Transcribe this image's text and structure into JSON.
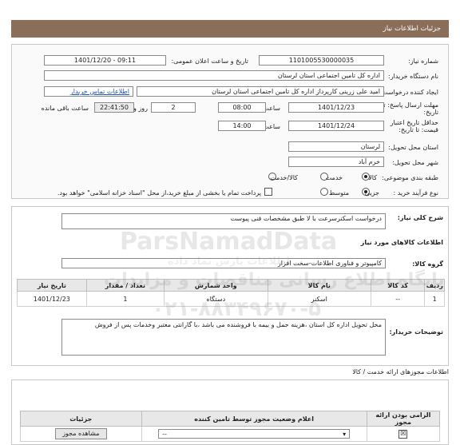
{
  "title": "جزئیات اطلاعات نیاز",
  "fields": {
    "need_number_label": "شماره نیاز:",
    "need_number": "1101005530000035",
    "announce_label": "تاریخ و ساعت اعلان عمومی:",
    "announce_value": "1401/12/20 - 09:11",
    "buyer_org_label": "نام دستگاه خریدار:",
    "buyer_org": "اداره کل تامین اجتماعی استان لرستان",
    "creator_label": "ایجاد کننده درخواست:",
    "creator": "امید علی زرینی کارپرداز اداره کل تامین اجتماعی استان لرستان",
    "contact_link": "اطلاعات تماس خریدار",
    "deadline_label": "مهلت ارسال پاسخ: تا تاریخ:",
    "deadline_date": "1401/12/23",
    "time_label": "ساعت",
    "deadline_time": "08:00",
    "days_value": "2",
    "days_label": "روز و",
    "remaining_time": "22:41:50",
    "remaining_label": "ساعت باقی مانده",
    "validity_label": "حداقل تاریخ اعتبار قیمت: تا تاریخ:",
    "validity_date": "1401/12/24",
    "validity_time": "14:00",
    "province_label": "استان محل تحویل:",
    "province": "لرستان",
    "city_label": "شهر محل تحویل:",
    "city": "خرم آباد",
    "category_label": "طبقه بندی موضوعی:",
    "category_options": [
      "کالا",
      "خدمت",
      "کالا/خدمت"
    ],
    "purchase_label": "نوع فرآیند خرید :",
    "purchase_options": [
      "جزیی",
      "متوسط"
    ],
    "payment_note": "پرداخت تمام یا بخشی از مبلغ خرید،از محل \"اسناد خزانه اسلامی\" خواهد بود."
  },
  "description": {
    "label": "شرح کلی نیاز:",
    "value": "درخواست اسکنرسرعت با لا طبق مشخصات فنی پیوست"
  },
  "goods_info_label": "اطلاعات کالاهای مورد نیاز",
  "goods_group": {
    "label": "گروه کالا:",
    "value": "کامپیوتر و فناوری اطلاعات-سخت افزار"
  },
  "items_table": {
    "headers": [
      "ردیف",
      "کد کالا",
      "نام کالا",
      "واحد شمارش",
      "تعداد / مقدار",
      "تاریخ نیاز"
    ],
    "rows": [
      [
        "1",
        "--",
        "اسکنر",
        "دستگاه",
        "1",
        "1401/12/23"
      ]
    ]
  },
  "buyer_notes": {
    "label": "توضیحات خریدار:",
    "value": "محل  تحویل اداره کل استان ،هزینه حمل  و بیمه با فروشنده می باشد ،با گارانتی معتبر وخدمات پس از فروش"
  },
  "services_title": "اطلاعات مجوزهای ارائه خدمت / کالا",
  "permits_table": {
    "headers": [
      "الزامی بودن ارائه مجوز",
      "اعلام وضعیت مجوز توسط تامین کننده",
      "جزئیات"
    ],
    "status_value": "--",
    "view_button": "مشاهده مجوز"
  },
  "watermark": {
    "brand": "ParsNamadData",
    "site": "پایگاه اطلاع رسانی مناقصات و مزایدات",
    "phone": "۰۲۱-۸۸۳۴۹۶۷۰-۵",
    "faded": "اطلاعات پارس نماد داده"
  }
}
